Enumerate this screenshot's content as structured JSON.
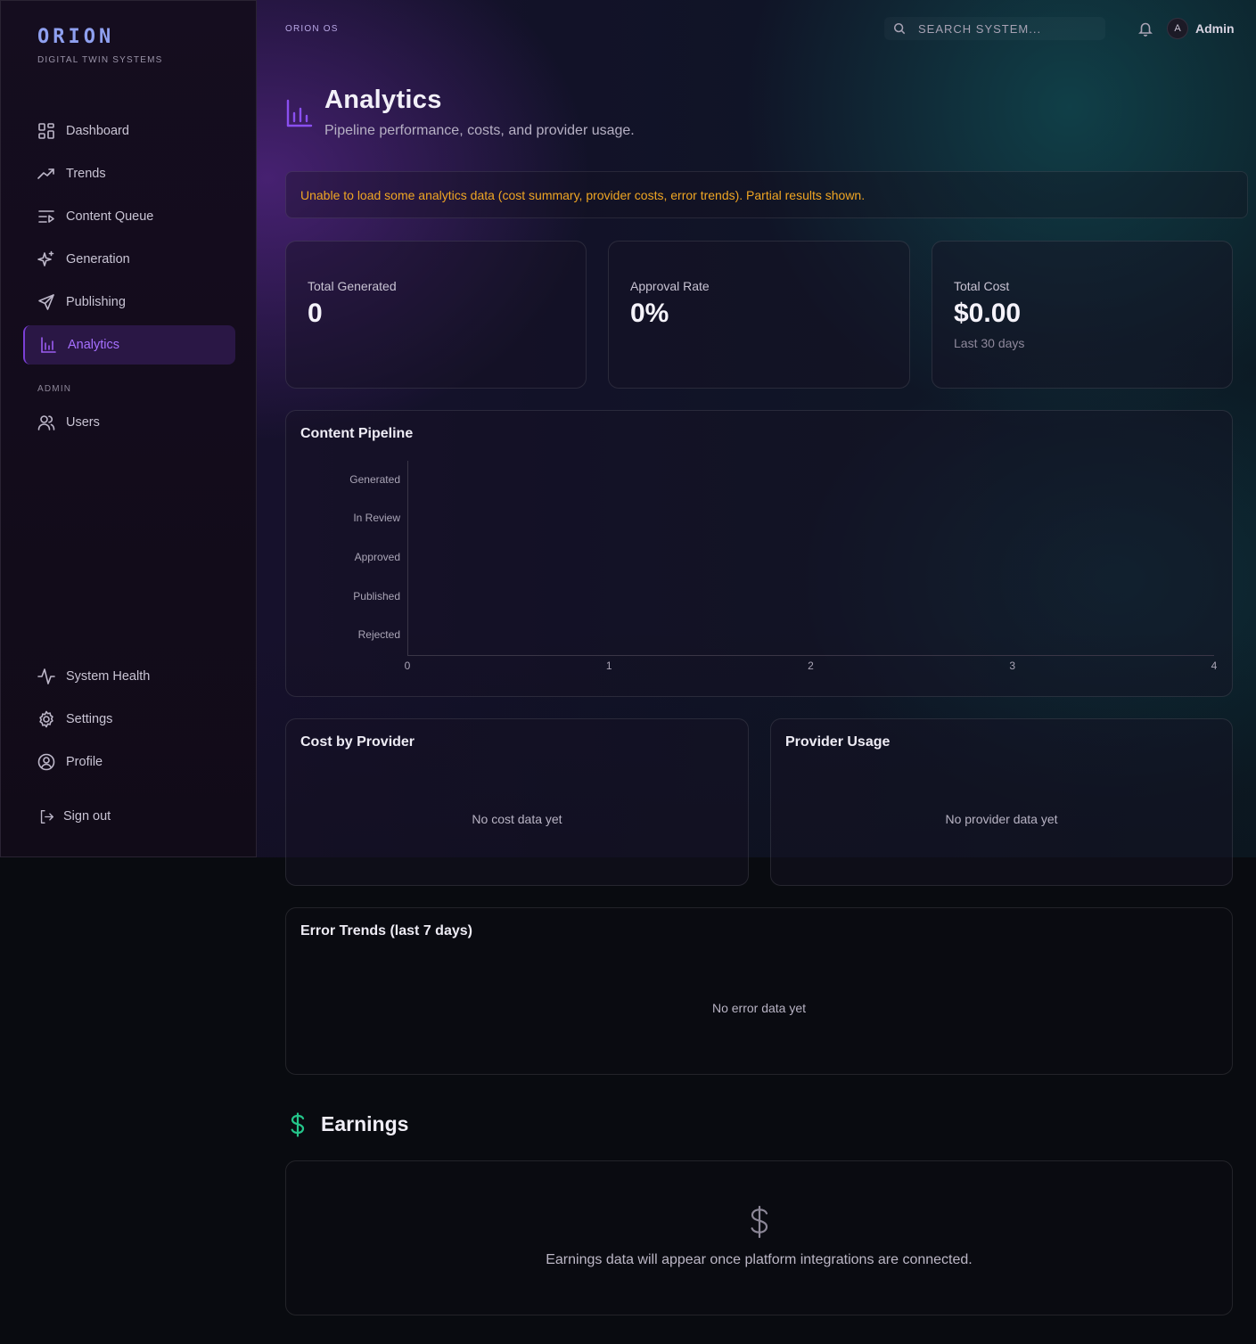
{
  "brand": {
    "name": "ORION",
    "tagline": "DIGITAL TWIN SYSTEMS"
  },
  "sidebar": {
    "items": [
      {
        "label": "Dashboard",
        "icon": "grid-icon"
      },
      {
        "label": "Trends",
        "icon": "trending-up-icon"
      },
      {
        "label": "Content Queue",
        "icon": "list-play-icon"
      },
      {
        "label": "Generation",
        "icon": "sparkles-icon"
      },
      {
        "label": "Publishing",
        "icon": "send-icon"
      },
      {
        "label": "Analytics",
        "icon": "bar-chart-icon",
        "active": true
      }
    ],
    "admin_label": "ADMIN",
    "admin_items": [
      {
        "label": "Users",
        "icon": "users-icon"
      }
    ],
    "bottom_items": [
      {
        "label": "System Health",
        "icon": "activity-icon"
      },
      {
        "label": "Settings",
        "icon": "gear-icon"
      },
      {
        "label": "Profile",
        "icon": "user-circle-icon"
      }
    ],
    "sign_out": "Sign out"
  },
  "topbar": {
    "breadcrumb": "ORION OS",
    "search_placeholder": "SEARCH SYSTEM...",
    "avatar_initial": "A",
    "user_name": "Admin"
  },
  "page": {
    "title": "Analytics",
    "subtitle": "Pipeline performance, costs, and provider usage."
  },
  "alert": "Unable to load some analytics data (cost summary, provider costs, error trends). Partial results shown.",
  "stats": [
    {
      "label": "Total Generated",
      "value": "0"
    },
    {
      "label": "Approval Rate",
      "value": "0%"
    },
    {
      "label": "Total Cost",
      "value": "$0.00",
      "note": "Last 30 days"
    }
  ],
  "pipeline": {
    "title": "Content Pipeline",
    "chart_data": {
      "type": "bar",
      "orientation": "horizontal",
      "categories": [
        "Generated",
        "In Review",
        "Approved",
        "Published",
        "Rejected"
      ],
      "values": [
        0,
        0,
        0,
        0,
        0
      ],
      "xticks": [
        "0",
        "1",
        "2",
        "3",
        "4"
      ],
      "xlim": [
        0,
        4
      ],
      "title": "Content Pipeline",
      "xlabel": "",
      "ylabel": "",
      "grid": false
    }
  },
  "cost_by_provider": {
    "title": "Cost by Provider",
    "empty": "No cost data yet"
  },
  "provider_usage": {
    "title": "Provider Usage",
    "empty": "No provider data yet"
  },
  "error_trends": {
    "title": "Error Trends (last 7 days)",
    "empty": "No error data yet"
  },
  "earnings": {
    "title": "Earnings",
    "empty": "Earnings data will appear once platform integrations are connected."
  },
  "colors": {
    "accent": "#8a4ff0",
    "active_text": "#a670ff",
    "warning": "#f0a623",
    "earnings": "#24c58a",
    "brand": "#8fa0f0"
  }
}
